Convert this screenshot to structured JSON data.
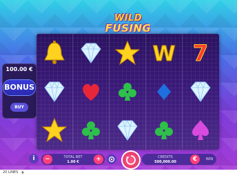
{
  "logo": {
    "line1": "WILD",
    "line2": "FUSING"
  },
  "bonus": {
    "amount": "100.00 €",
    "label": "BONUS",
    "buy_label": "BUY"
  },
  "reels": [
    [
      "bell",
      "diamond",
      "star"
    ],
    [
      "diamond",
      "heart",
      "diamond"
    ],
    [
      "star",
      "club",
      "diamond"
    ],
    [
      "wild",
      "diamond",
      "club"
    ],
    [
      "seven",
      "diamond",
      "spade"
    ]
  ],
  "symbol_labels": {
    "wild": "W",
    "seven": "7"
  },
  "controls": {
    "info_icon": "i",
    "minus_icon": "−",
    "plus_icon": "+",
    "total_bet_label": "TOTAL BET",
    "total_bet_value": "1.00 €",
    "credits_label": "CREDITS",
    "credits_value": "500,000.00",
    "win_label": "WIN",
    "currency_badge": "€"
  },
  "footer": {
    "lines_text": "20 LINES"
  },
  "colors": {
    "accent": "#7d3cd8",
    "bet_bg": "#4e2b9a",
    "gold": "#ffd21f",
    "heart": "#e8263a",
    "club": "#2ec04a",
    "spade": "#d94adf",
    "blue_diamond": "#1f6fe0"
  }
}
